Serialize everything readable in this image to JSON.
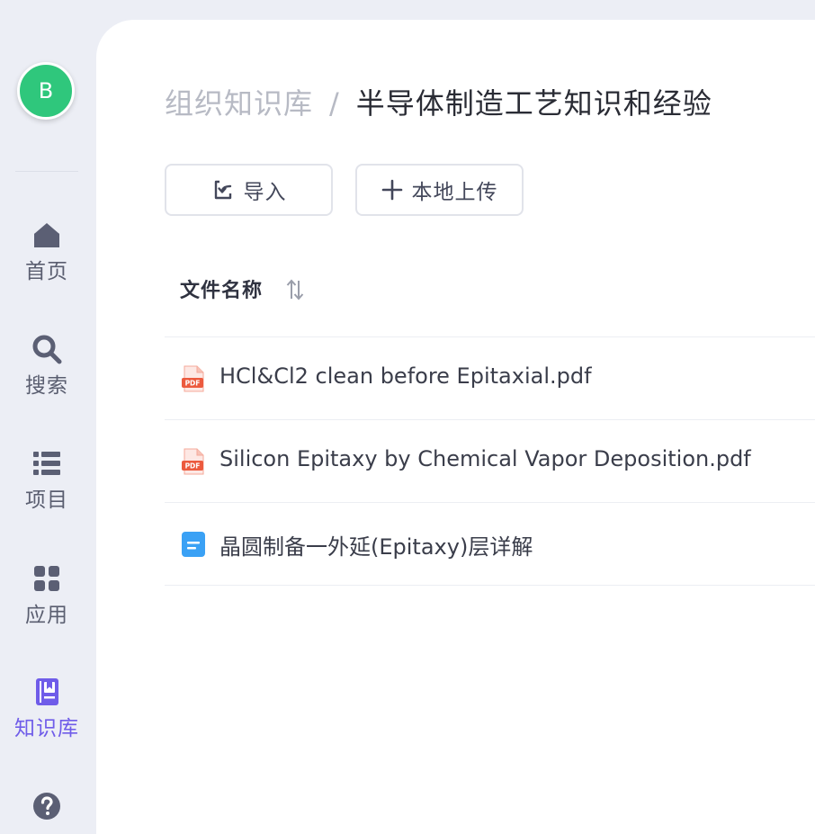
{
  "user": {
    "avatar_initial": "B",
    "avatar_color": "#2fc77c"
  },
  "sidebar": {
    "items": [
      {
        "label": "首页",
        "icon": "home-icon",
        "active": false
      },
      {
        "label": "搜索",
        "icon": "search-icon",
        "active": false
      },
      {
        "label": "项目",
        "icon": "list-icon",
        "active": false
      },
      {
        "label": "应用",
        "icon": "grid-icon",
        "active": false
      },
      {
        "label": "知识库",
        "icon": "book-icon",
        "active": true
      },
      {
        "label": "",
        "icon": "help-icon",
        "active": false
      }
    ],
    "active_color": "#6f5ce9"
  },
  "breadcrumb": {
    "root": "组织知识库",
    "separator": "/",
    "current": "半导体制造工艺知识和经验"
  },
  "toolbar": {
    "import_label": "导入",
    "upload_label": "本地上传"
  },
  "table": {
    "header": {
      "name_label": "文件名称"
    },
    "rows": [
      {
        "name": "HCl&Cl2 clean before Epitaxial.pdf",
        "type": "pdf",
        "icon": "pdf-file-icon"
      },
      {
        "name": "Silicon Epitaxy by Chemical Vapor Deposition.pdf",
        "type": "pdf",
        "icon": "pdf-file-icon"
      },
      {
        "name": "晶圆制备一外延(Epitaxy)层详解",
        "type": "doc",
        "icon": "doc-file-icon"
      }
    ]
  }
}
